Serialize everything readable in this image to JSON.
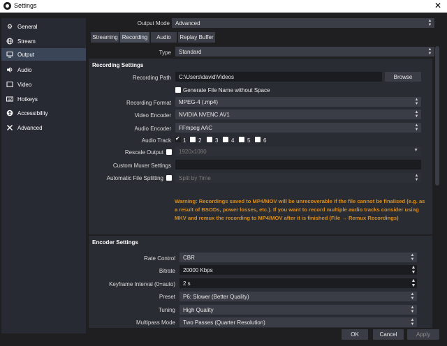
{
  "window": {
    "title": "Settings"
  },
  "sidebar": {
    "items": [
      {
        "label": "General",
        "icon": "gear-icon"
      },
      {
        "label": "Stream",
        "icon": "globe-icon"
      },
      {
        "label": "Output",
        "icon": "monitor-icon",
        "active": true
      },
      {
        "label": "Audio",
        "icon": "speaker-icon"
      },
      {
        "label": "Video",
        "icon": "video-icon"
      },
      {
        "label": "Hotkeys",
        "icon": "keyboard-icon"
      },
      {
        "label": "Accessibility",
        "icon": "accessibility-icon"
      },
      {
        "label": "Advanced",
        "icon": "wrench-icon"
      }
    ]
  },
  "output_mode": {
    "label": "Output Mode",
    "value": "Advanced"
  },
  "tabs": [
    {
      "label": "Streaming"
    },
    {
      "label": "Recording",
      "active": true
    },
    {
      "label": "Audio"
    },
    {
      "label": "Replay Buffer"
    }
  ],
  "type": {
    "label": "Type",
    "value": "Standard"
  },
  "recording": {
    "title": "Recording Settings",
    "path_label": "Recording Path",
    "path_value": "C:\\Users\\david\\Videos",
    "browse_label": "Browse",
    "nospace_label": "Generate File Name without Space",
    "format_label": "Recording Format",
    "format_value": "MPEG-4 (.mp4)",
    "video_encoder_label": "Video Encoder",
    "video_encoder_value": "NVIDIA NVENC AV1",
    "audio_encoder_label": "Audio Encoder",
    "audio_encoder_value": "FFmpeg AAC",
    "audio_track_label": "Audio Track",
    "tracks": [
      "1",
      "2",
      "3",
      "4",
      "5",
      "6"
    ],
    "rescale_label": "Rescale Output",
    "rescale_value": "1920x1080",
    "muxer_label": "Custom Muxer Settings",
    "muxer_value": "",
    "split_label": "Automatic File Splitting",
    "split_value": "Split by Time",
    "warning": "Warning: Recordings saved to MP4/MOV will be unrecoverable if the file cannot be finalised (e.g. as a result of BSODs, power losses, etc.). If you want to record multiple audio tracks consider using MKV and remux the recording to MP4/MOV after it is finished (File → Remux Recordings)"
  },
  "encoder": {
    "title": "Encoder Settings",
    "rate_control_label": "Rate Control",
    "rate_control_value": "CBR",
    "bitrate_label": "Bitrate",
    "bitrate_value": "20000 Kbps",
    "keyframe_label": "Keyframe Interval (0=auto)",
    "keyframe_value": "2 s",
    "preset_label": "Preset",
    "preset_value": "P6: Slower (Better Quality)",
    "tuning_label": "Tuning",
    "tuning_value": "High Quality",
    "multipass_label": "Multipass Mode",
    "multipass_value": "Two Passes (Quarter Resolution)"
  },
  "footer": {
    "ok": "OK",
    "cancel": "Cancel",
    "apply": "Apply"
  }
}
